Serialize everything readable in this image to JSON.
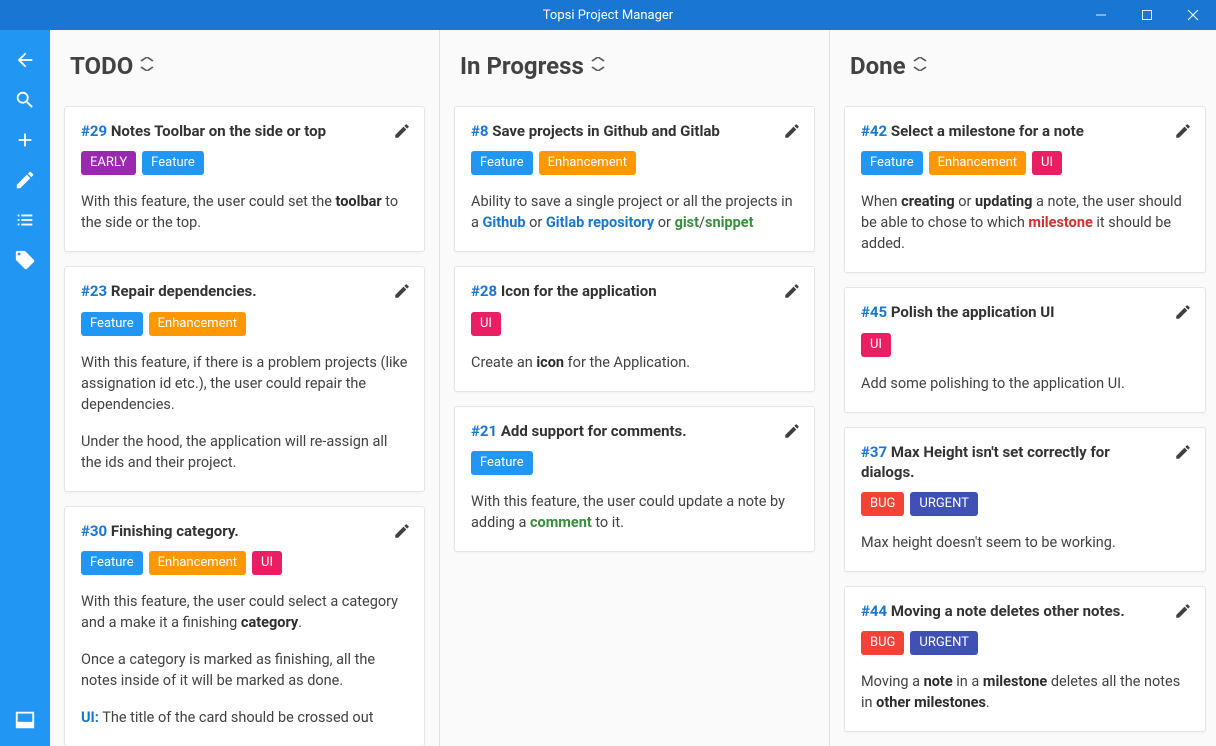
{
  "app": {
    "title": "Topsi Project Manager"
  },
  "tag_colors": {
    "EARLY": "#9c27b0",
    "Feature": "#2196f3",
    "Enhancement": "#ff9800",
    "UI": "#e91e63",
    "BUG": "#f44336",
    "URGENT": "#3f51b5"
  },
  "columns": [
    {
      "title": "TODO",
      "cards": [
        {
          "id": "#29",
          "title": "Notes Toolbar on the side or top",
          "tags": [
            "EARLY",
            "Feature"
          ],
          "body_html": "<p>With this feature, the user could set the <b>toolbar</b> to the side or the top.</p>"
        },
        {
          "id": "#23",
          "title": "Repair dependencies.",
          "tags": [
            "Feature",
            "Enhancement"
          ],
          "body_html": "<p>With this feature, if there is a problem projects (like assignation id etc.), the user could repair the dependencies.</p><p>Under the hood, the application will re-assign all the ids and their project.</p>"
        },
        {
          "id": "#30",
          "title": "Finishing category.",
          "tags": [
            "Feature",
            "Enhancement",
            "UI"
          ],
          "body_html": "<p>With this feature, the user could select a category and a make it a finishing <b>category</b>.</p><p>Once a category is marked as finishing, all the notes inside of it will be marked as done.</p><p><span class='link'>UI:</span> The title of the card should be crossed out</p>"
        }
      ]
    },
    {
      "title": "In Progress",
      "cards": [
        {
          "id": "#8",
          "title": "Save projects in Github and Gitlab",
          "tags": [
            "Feature",
            "Enhancement"
          ],
          "body_html": "<p>Ability to save a single project or all the projects in a <span class='link'>Github</span> or <span class='link'>Gitlab repository</span> or <span class='green'>gist</span>/<span class='green'>snippet</span></p>"
        },
        {
          "id": "#28",
          "title": "Icon for the application",
          "tags": [
            "UI"
          ],
          "body_html": "<p>Create an <b>icon</b> for the Application.</p>"
        },
        {
          "id": "#21",
          "title": "Add support for comments.",
          "tags": [
            "Feature"
          ],
          "body_html": "<p>With this feature, the user could update a note by adding a <span class='green'>comment</span> to it.</p>"
        }
      ]
    },
    {
      "title": "Done",
      "cards": [
        {
          "id": "#42",
          "title": "Select a milestone for a note",
          "tags": [
            "Feature",
            "Enhancement",
            "UI"
          ],
          "body_html": "<p>When <b>creating</b> or <b>updating</b> a note, the user should be able to chose to which <span class='red'>milestone</span> it should be added.</p>"
        },
        {
          "id": "#45",
          "title": "Polish the application UI",
          "tags": [
            "UI"
          ],
          "body_html": "<p>Add some polishing to the application UI.</p>"
        },
        {
          "id": "#37",
          "title": "Max Height isn't set correctly for dialogs.",
          "tags": [
            "BUG",
            "URGENT"
          ],
          "body_html": "<p>Max height doesn't seem to be working.</p>"
        },
        {
          "id": "#44",
          "title": "Moving a note deletes other notes.",
          "tags": [
            "BUG",
            "URGENT"
          ],
          "body_html": "<p>Moving a <b>note</b> in a <b>milestone</b> deletes all the notes in <b>other milestones</b>.</p>"
        }
      ]
    }
  ]
}
